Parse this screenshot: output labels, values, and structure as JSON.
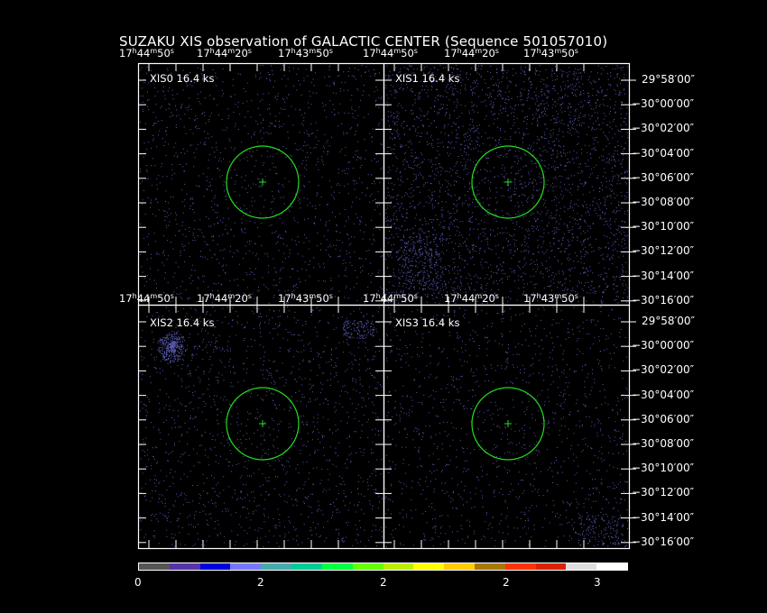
{
  "title": "SUZAKU XIS observation of GALACTIC CENTER  (Sequence 501057010)",
  "panels": [
    {
      "label": "XIS0 16.4 ks"
    },
    {
      "label": "XIS1 16.4 ks"
    },
    {
      "label": "XIS2 16.4 ks"
    },
    {
      "label": "XIS3 16.4 ks"
    }
  ],
  "ra_ticks": [
    {
      "h": "17",
      "m": "44",
      "s": "50"
    },
    {
      "h": "17",
      "m": "44",
      "s": "20"
    },
    {
      "h": "17",
      "m": "43",
      "s": "50"
    }
  ],
  "ra_units": {
    "h": "h",
    "m": "m",
    "s": "s"
  },
  "dec_ticks": [
    "29°58′00″",
    "30°00′00″",
    "30°02′00″",
    "30°04′00″",
    "30°06′00″",
    "30°08′00″",
    "30°10′00″",
    "30°12′00″",
    "30°14′00″",
    "30°16′00″"
  ],
  "dec_sign": "−",
  "colorbar": {
    "colors": [
      "#555555",
      "#5533aa",
      "#0000dd",
      "#7777ff",
      "#44aaaa",
      "#00cc99",
      "#00ff44",
      "#66ff00",
      "#bbee00",
      "#ffff00",
      "#ffcc00",
      "#aa7700",
      "#ff3300",
      "#dd2200",
      "#dddddd",
      "#ffffff"
    ],
    "ticks": [
      "0",
      "2",
      "2",
      "2",
      "3"
    ]
  },
  "colors": {
    "circle": "#22dd22",
    "frame": "#ffffff",
    "photons": "#8080ff"
  }
}
